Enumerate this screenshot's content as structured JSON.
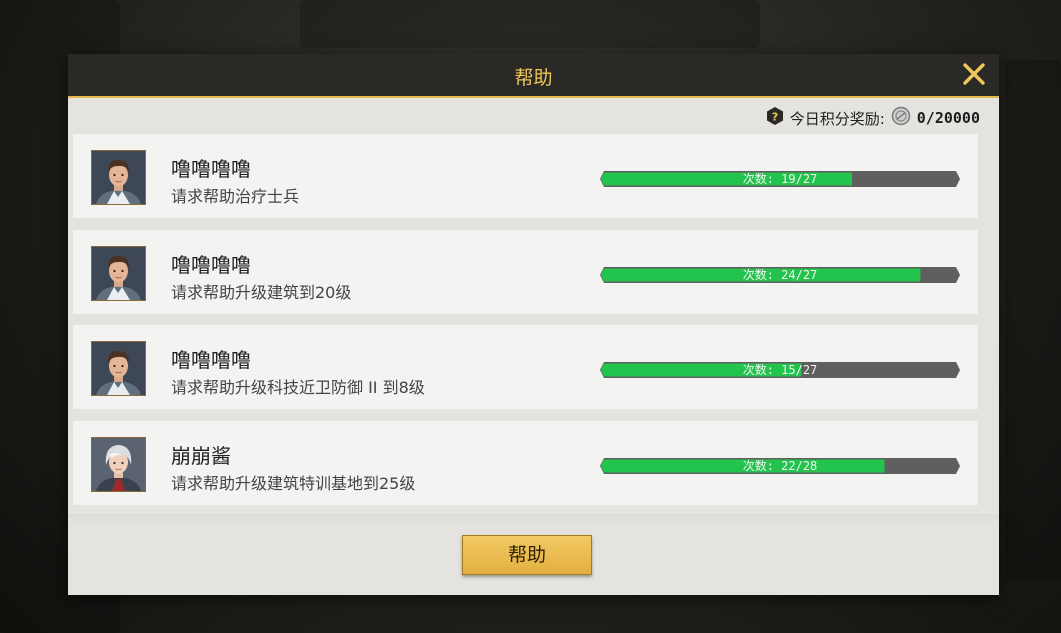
{
  "dialog": {
    "title": "帮助",
    "daily_reward_label": "今日积分奖励:",
    "daily_reward_value": "0/20000",
    "help_button_label": "帮助"
  },
  "requests": [
    {
      "name": "噜噜噜噜",
      "desc": "请求帮助治疗士兵",
      "count_label": "次数: 19/27",
      "progress": 0.7,
      "avatar": "male-avatar"
    },
    {
      "name": "噜噜噜噜",
      "desc": "请求帮助升级建筑到20级",
      "count_label": "次数: 24/27",
      "progress": 0.89,
      "avatar": "male-avatar"
    },
    {
      "name": "噜噜噜噜",
      "desc": "请求帮助升级科技近卫防御 II 到8级",
      "count_label": "次数: 15/27",
      "progress": 0.56,
      "avatar": "male-avatar"
    },
    {
      "name": "崩崩酱",
      "desc": "请求帮助升级建筑特训基地到25级",
      "count_label": "次数: 22/28",
      "progress": 0.79,
      "avatar": "silver-hair-avatar"
    }
  ],
  "colors": {
    "accent_gold": "#e2b94a",
    "progress_green": "#22c44d",
    "progress_track": "#5f5f5f"
  }
}
